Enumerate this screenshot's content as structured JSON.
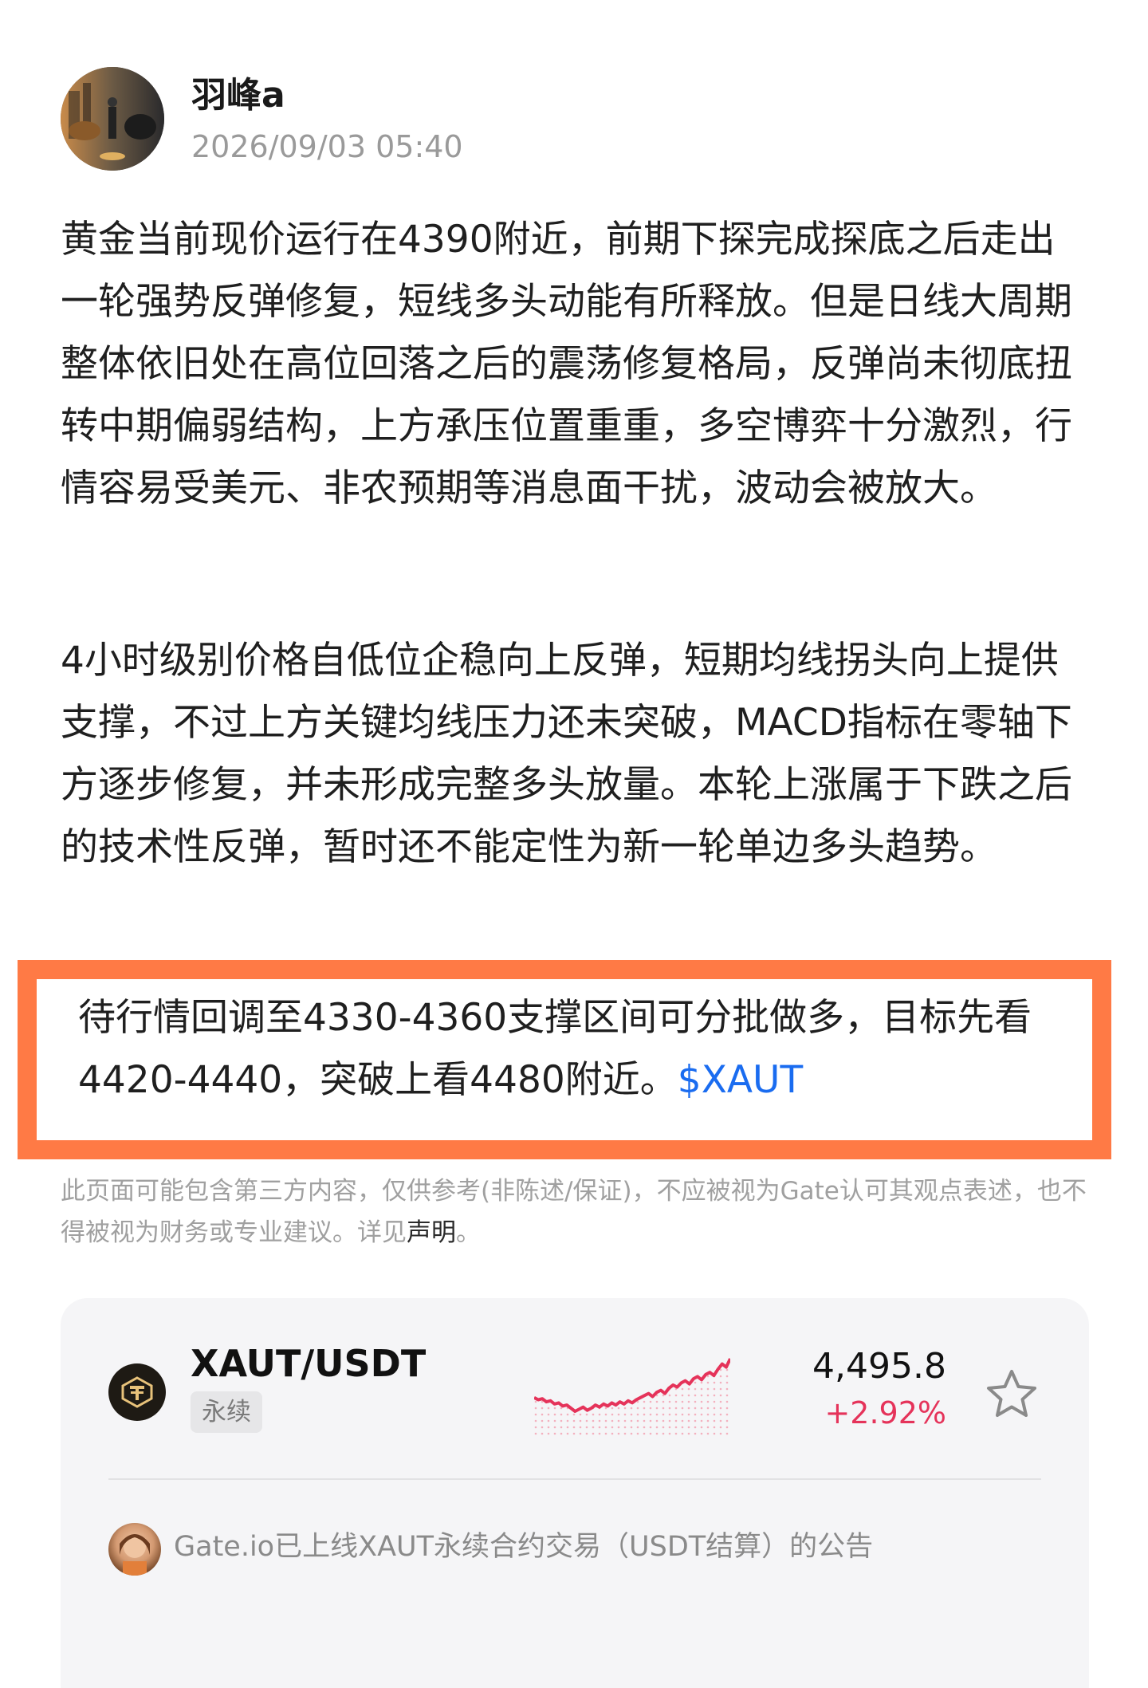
{
  "author": {
    "name": "羽峰a",
    "timestamp": "2026/09/03 05:40"
  },
  "post": {
    "paragraph1": "黄金当前现价运行在4390附近，前期下探完成探底之后走出一轮强势反弹修复，短线多头动能有所释放。但是日线大周期整体依旧处在高位回落之后的震荡修复格局，反弹尚未彻底扭转中期偏弱结构，上方承压位置重重，多空博弈十分激烈，行情容易受美元、非农预期等消息面干扰，波动会被放大。",
    "paragraph2": "4小时级别价格自低位企稳向上反弹，短期均线拐头向上提供支撑，不过上方关键均线压力还未突破，MACD指标在零轴下方逐步修复，并未形成完整多头放量。本轮上涨属于下跌之后的技术性反弹，暂时还不能定性为新一轮单边多头趋势。",
    "highlight": "待行情回调至4330-4360支撑区间可分批做多，目标先看4420-4440，突破上看4480附近。",
    "ticker_tag": "$XAUT"
  },
  "disclaimer": {
    "text": "此页面可能包含第三方内容，仅供参考(非陈述/保证)，不应被视为Gate认可其观点表述，也不得被视为财务或专业建议。详见",
    "link_label": "声明",
    "suffix": "。"
  },
  "market_card": {
    "pair": "XAUT/USDT",
    "badge": "永续",
    "price": "4,495.8",
    "change": "+2.92%",
    "sparkline": [
      42,
      44,
      43,
      46,
      45,
      48,
      47,
      50,
      49,
      52,
      55,
      53,
      51,
      54,
      52,
      49,
      51,
      48,
      50,
      47,
      49,
      46,
      48,
      45,
      47,
      44,
      42,
      40,
      38,
      41,
      37,
      35,
      38,
      33,
      30,
      32,
      28,
      26,
      29,
      24,
      22,
      25,
      20,
      18,
      21,
      15,
      10,
      13,
      5
    ],
    "colors": {
      "up": "#e5335a"
    }
  },
  "announcement": {
    "text": "Gate.io已上线XAUT永续合约交易（USDT结算）的公告"
  },
  "colors": {
    "highlight_border": "#ff7a45",
    "link": "#1a6cf0"
  }
}
